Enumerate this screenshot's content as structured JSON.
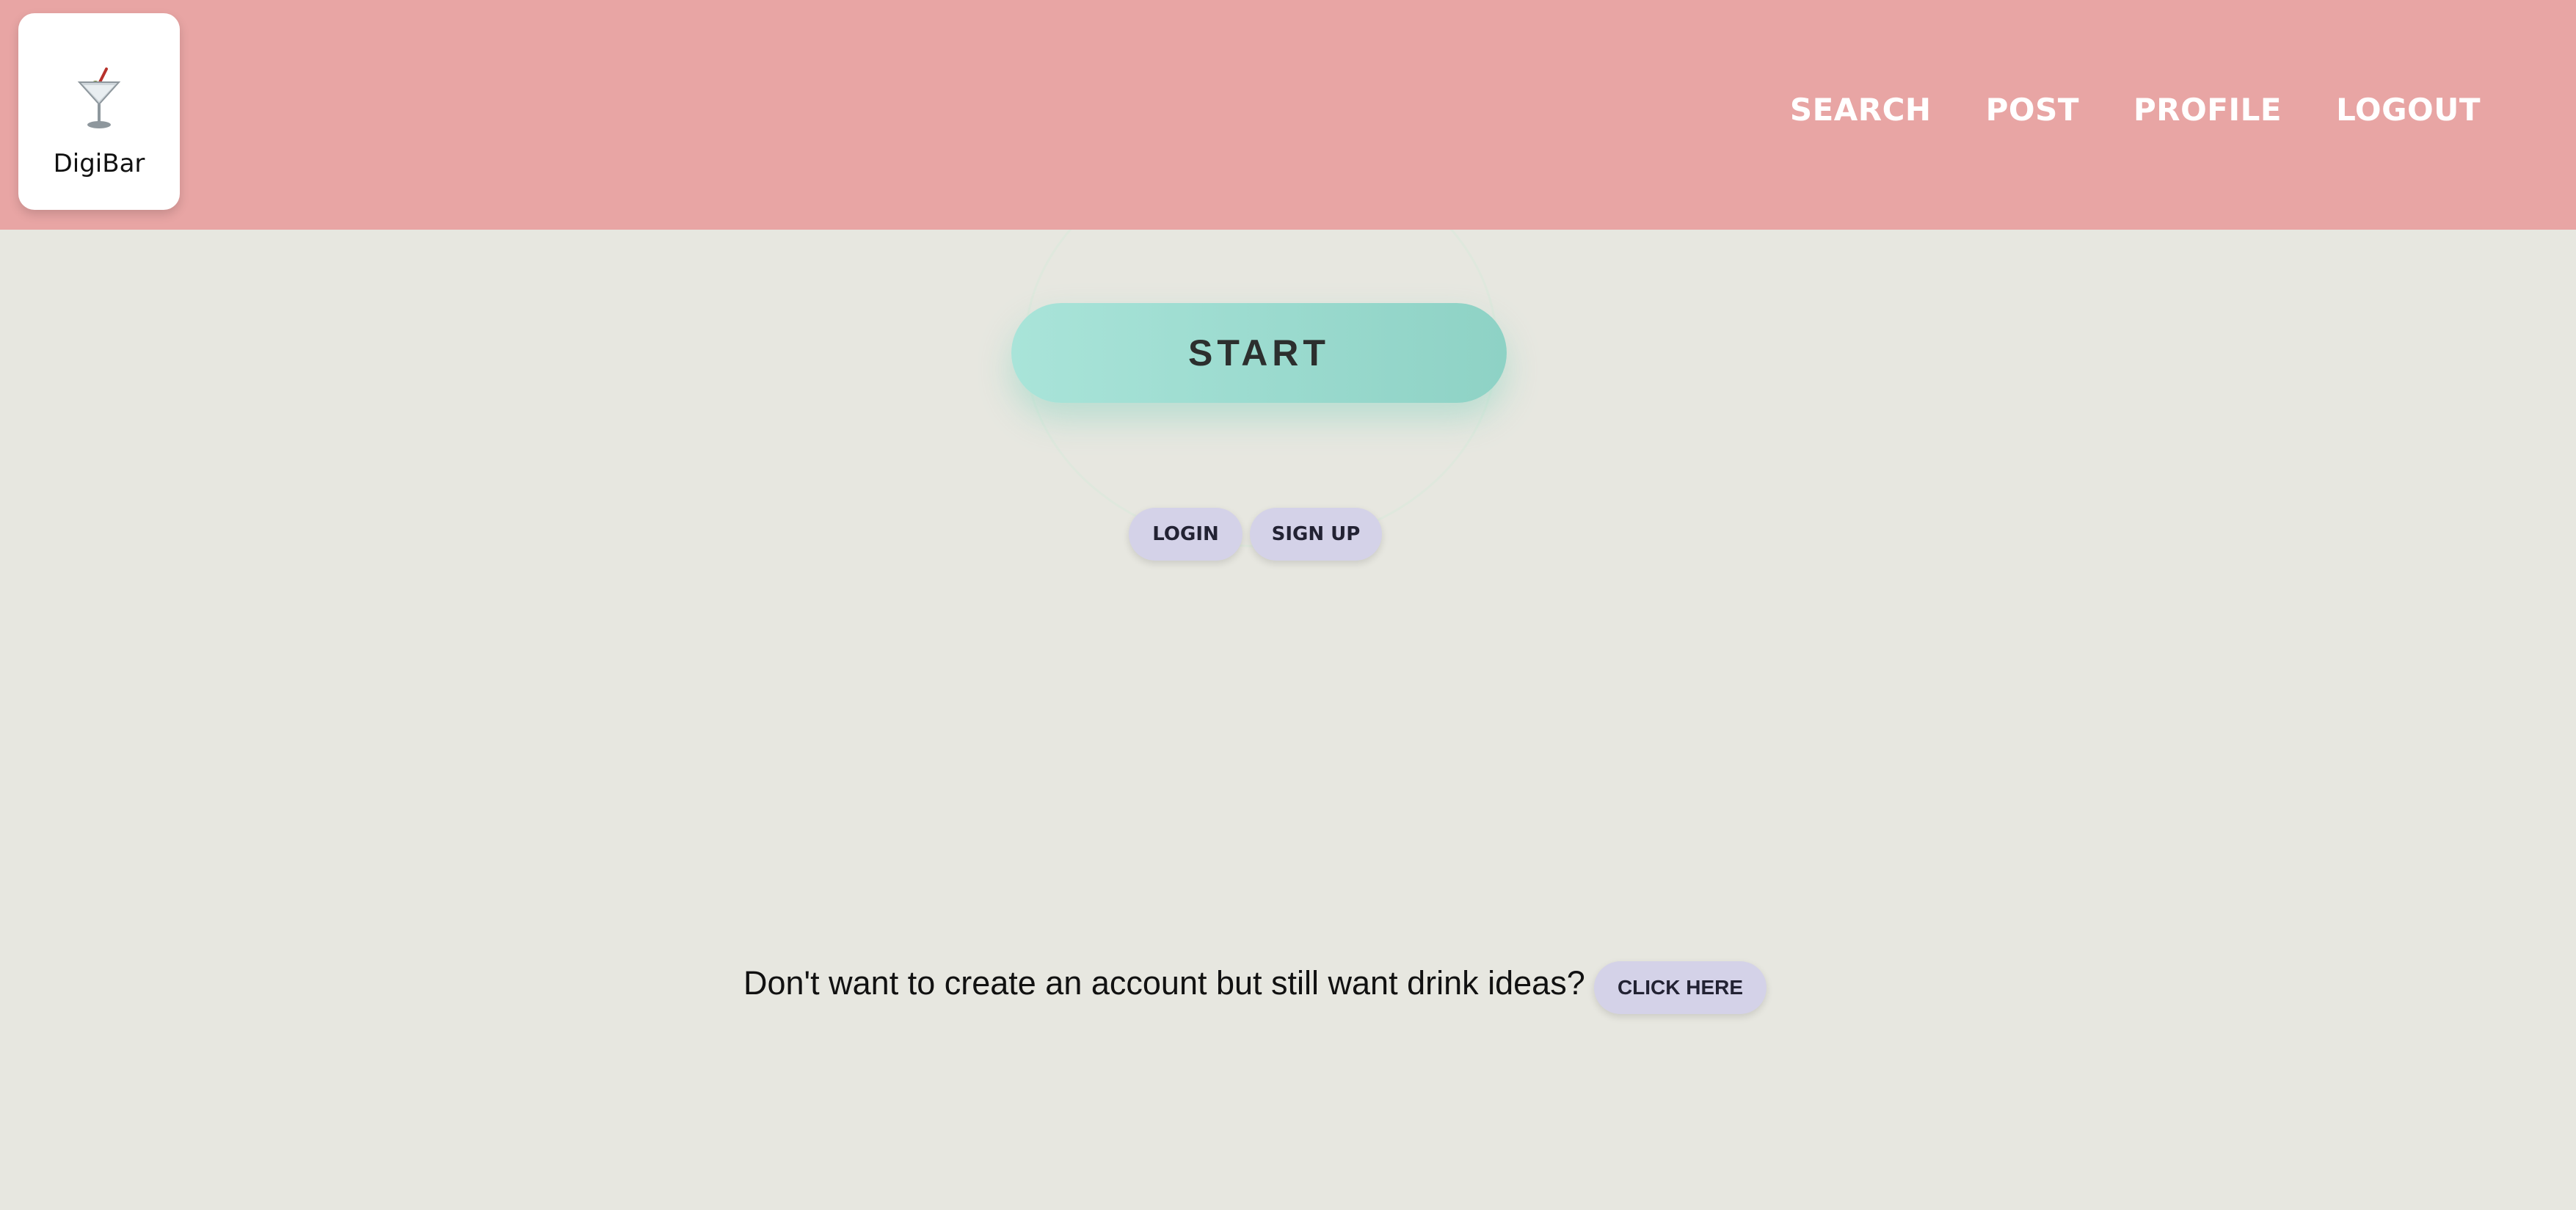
{
  "brand": {
    "name": "DigiBar",
    "icon": "martini-glass-icon"
  },
  "nav": {
    "items": [
      "SEARCH",
      "POST",
      "PROFILE",
      "LOGOUT"
    ]
  },
  "main": {
    "start_label": "START",
    "login_label": "LOGIN",
    "signup_label": "SIGN UP",
    "guest_prompt": "Don't want to create an account but still want drink ideas?",
    "guest_button_label": "CLICK HERE"
  },
  "colors": {
    "header": "#e8a5a4",
    "background": "#e7e7e0",
    "start_button": "#9ddbd0",
    "pill_button": "#d4d2e8"
  }
}
